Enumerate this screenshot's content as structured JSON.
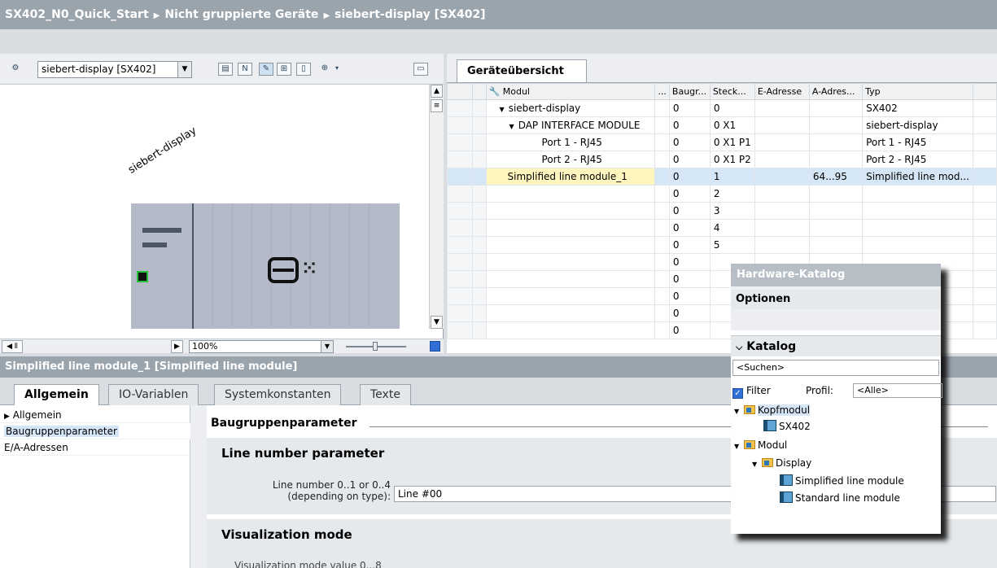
{
  "breadcrumb": [
    "SX402_N0_Quick_Start",
    "Nicht gruppierte Geräte",
    "siebert-display [SX402]"
  ],
  "device_view": {
    "device_select": "siebert-display [SX402]",
    "device_label": "siebert-display",
    "zoom": "100%"
  },
  "overview": {
    "tab": "Geräteübersicht",
    "columns": [
      "Modul",
      "...",
      "Baugr...",
      "Steck...",
      "E-Adresse",
      "A-Adres...",
      "Typ"
    ],
    "rows": [
      {
        "modul": "siebert-display",
        "tw": "▼",
        "baugr": "0",
        "steck": "0",
        "e": "",
        "a": "",
        "typ": "SX402"
      },
      {
        "modul": "DAP INTERFACE MODULE",
        "tw": "▼",
        "baugr": "0",
        "steck": "0 X1",
        "e": "",
        "a": "",
        "typ": "siebert-display"
      },
      {
        "modul": "Port 1 - RJ45",
        "tw": "",
        "baugr": "0",
        "steck": "0 X1 P1",
        "e": "",
        "a": "",
        "typ": "Port 1 - RJ45"
      },
      {
        "modul": "Port 2 - RJ45",
        "tw": "",
        "baugr": "0",
        "steck": "0 X1 P2",
        "e": "",
        "a": "",
        "typ": "Port 2 - RJ45"
      },
      {
        "modul": "Simplified line module_1",
        "tw": "",
        "baugr": "0",
        "steck": "1",
        "e": "",
        "a": "64...95",
        "typ": "Simplified line mod..."
      },
      {
        "modul": "",
        "tw": "",
        "baugr": "0",
        "steck": "2",
        "e": "",
        "a": "",
        "typ": ""
      },
      {
        "modul": "",
        "tw": "",
        "baugr": "0",
        "steck": "3",
        "e": "",
        "a": "",
        "typ": ""
      },
      {
        "modul": "",
        "tw": "",
        "baugr": "0",
        "steck": "4",
        "e": "",
        "a": "",
        "typ": ""
      },
      {
        "modul": "",
        "tw": "",
        "baugr": "0",
        "steck": "5",
        "e": "",
        "a": "",
        "typ": ""
      },
      {
        "modul": "",
        "tw": "",
        "baugr": "0",
        "steck": "",
        "e": "",
        "a": "",
        "typ": ""
      },
      {
        "modul": "",
        "tw": "",
        "baugr": "0",
        "steck": "",
        "e": "",
        "a": "",
        "typ": ""
      },
      {
        "modul": "",
        "tw": "",
        "baugr": "0",
        "steck": "",
        "e": "",
        "a": "",
        "typ": ""
      },
      {
        "modul": "",
        "tw": "",
        "baugr": "0",
        "steck": "",
        "e": "",
        "a": "",
        "typ": ""
      },
      {
        "modul": "",
        "tw": "",
        "baugr": "0",
        "steck": "",
        "e": "",
        "a": "",
        "typ": ""
      }
    ]
  },
  "properties": {
    "title": "Simplified line module_1 [Simplified line module]",
    "tabs": [
      "Allgemein",
      "IO-Variablen",
      "Systemkonstanten",
      "Texte"
    ],
    "nav": [
      "Allgemein",
      "Baugruppenparameter",
      "E/A-Adressen"
    ],
    "section": "Baugruppenparameter",
    "group1": "Line number parameter",
    "line_label_1": "Line number 0..1 or 0..4",
    "line_label_2": "(depending on type):",
    "line_value": "Line #00",
    "group2": "Visualization mode",
    "vis_label": "Visualization mode value 0...8"
  },
  "catalog": {
    "title": "Hardware-Katalog",
    "options": "Optionen",
    "katalog": "Katalog",
    "search_placeholder": "<Suchen>",
    "filter": "Filter",
    "profil_label": "Profil:",
    "profil_value": "<Alle>",
    "tree": {
      "kopfmodul": "Kopfmodul",
      "sx402": "SX402",
      "modul": "Modul",
      "display": "Display",
      "simplified": "Simplified line module",
      "standard": "Standard line module"
    }
  }
}
